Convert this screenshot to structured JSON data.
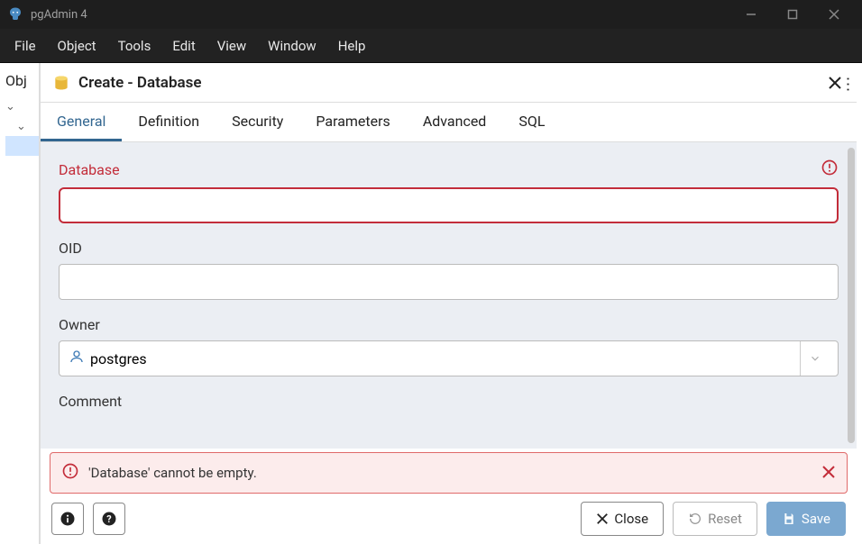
{
  "window": {
    "title": "pgAdmin 4"
  },
  "menubar": {
    "items": [
      "File",
      "Object",
      "Tools",
      "Edit",
      "View",
      "Window",
      "Help"
    ]
  },
  "sidebar": {
    "title": "Obj"
  },
  "dialog": {
    "title": "Create - Database",
    "tabs": [
      "General",
      "Definition",
      "Security",
      "Parameters",
      "Advanced",
      "SQL"
    ],
    "active_tab": 0,
    "fields": {
      "database": {
        "label": "Database",
        "value": "",
        "has_error": true
      },
      "oid": {
        "label": "OID",
        "value": ""
      },
      "owner": {
        "label": "Owner",
        "value": "postgres"
      },
      "comment": {
        "label": "Comment",
        "value": ""
      }
    },
    "error": {
      "message": "'Database' cannot be empty."
    },
    "footer": {
      "close": "Close",
      "reset": "Reset",
      "save": "Save"
    }
  }
}
